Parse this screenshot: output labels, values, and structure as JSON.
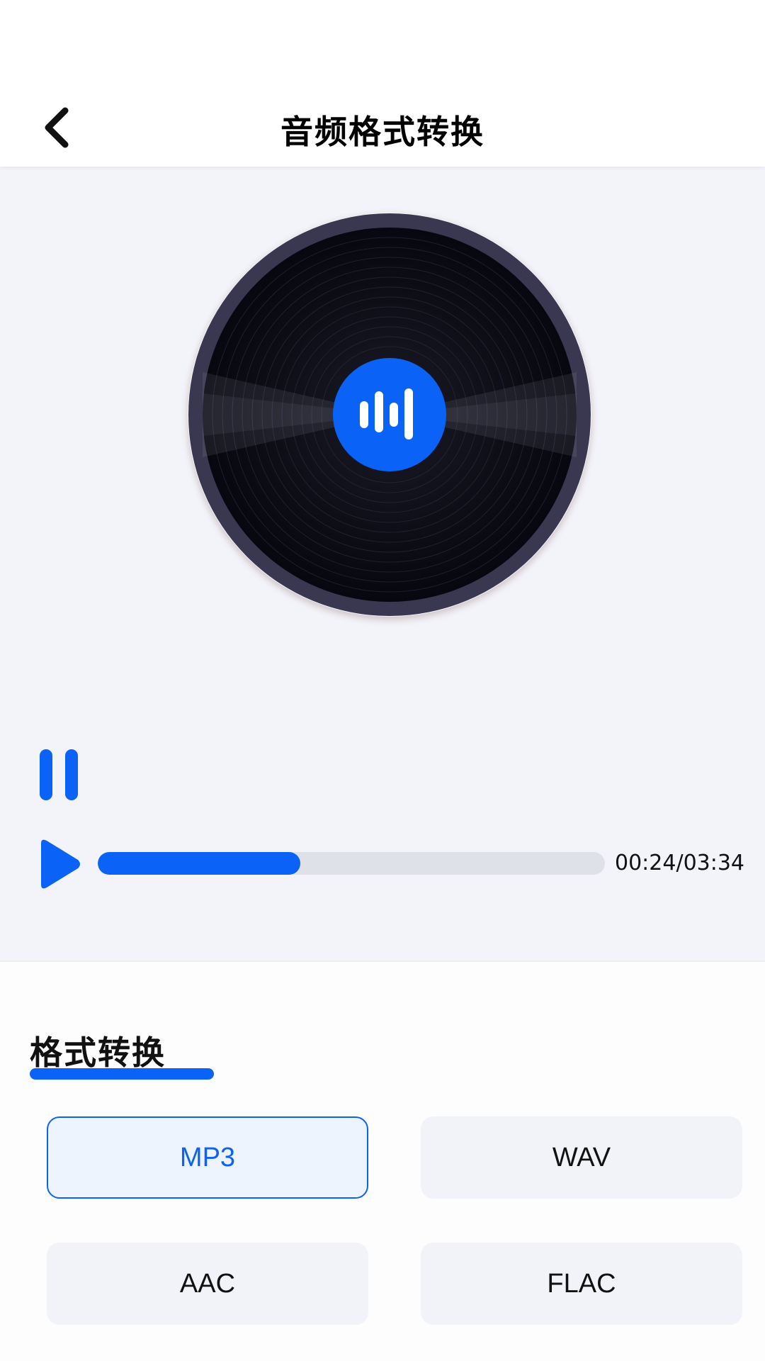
{
  "header": {
    "title": "音频格式转换",
    "back_icon": "chevron-left-icon"
  },
  "player": {
    "disc_icon": "vinyl-record-icon",
    "center_icon": "audio-wave-icon",
    "pause_icon": "pause-icon",
    "play_icon": "play-icon",
    "progress_fraction": 0.4,
    "time": "00:24/03:34"
  },
  "format": {
    "section_title": "格式转换",
    "options": [
      "MP3",
      "WAV",
      "AAC",
      "FLAC"
    ],
    "selected": "MP3"
  },
  "colors": {
    "accent": "#0a63f6",
    "background": "#f3f4f9",
    "disc": "#0b0b14"
  }
}
